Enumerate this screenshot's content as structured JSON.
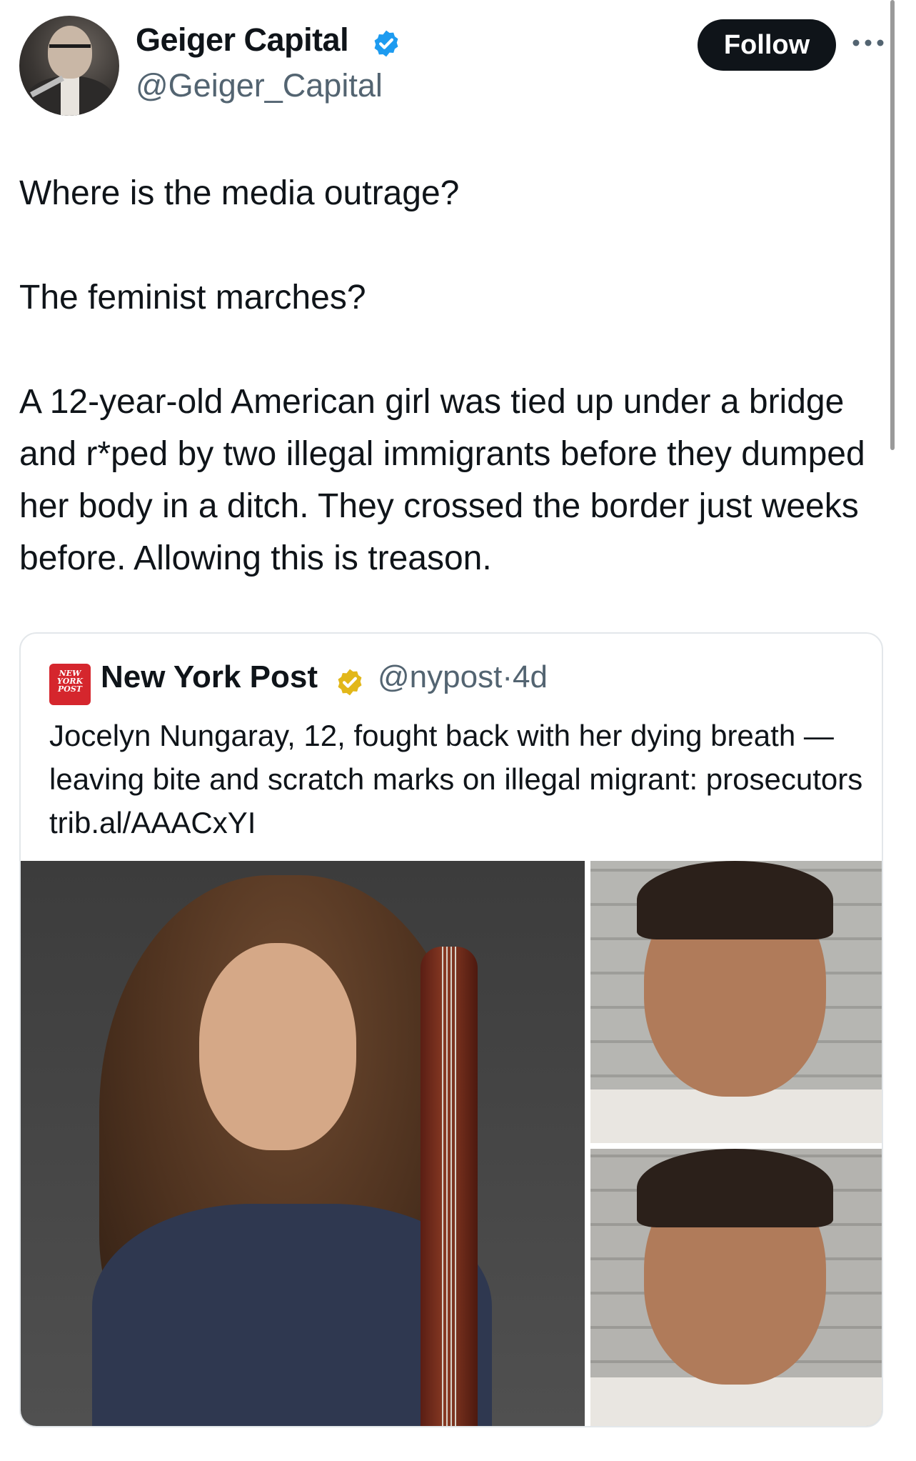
{
  "tweet": {
    "author": {
      "display_name": "Geiger Capital",
      "handle": "@Geiger_Capital",
      "verified_color": "#1d9bf0"
    },
    "follow_label": "Follow",
    "more_icon": "more-horizontal-icon",
    "text": "Where is the media outrage?\n\nThe feminist marches?\n\nA 12-year-old American girl was tied up under a bridge and r*ped by two illegal immigrants before they dumped her body in a ditch. They crossed the border just weeks before. Allowing this is treason."
  },
  "quote": {
    "logo_text": "NEW YORK POST",
    "display_name": "New York Post",
    "handle": "@nypost",
    "separator": "·",
    "time": "4d",
    "verified_color": "#e2b719",
    "text": "Jocelyn Nungaray, 12, fought back with her dying breath — leaving bite and scratch marks on illegal migrant: prosecutors trib.al/AAACxYI"
  },
  "colors": {
    "text_primary": "#0f1419",
    "text_secondary": "#536471",
    "border": "#e3e7ea",
    "brand_red": "#d5262d"
  }
}
